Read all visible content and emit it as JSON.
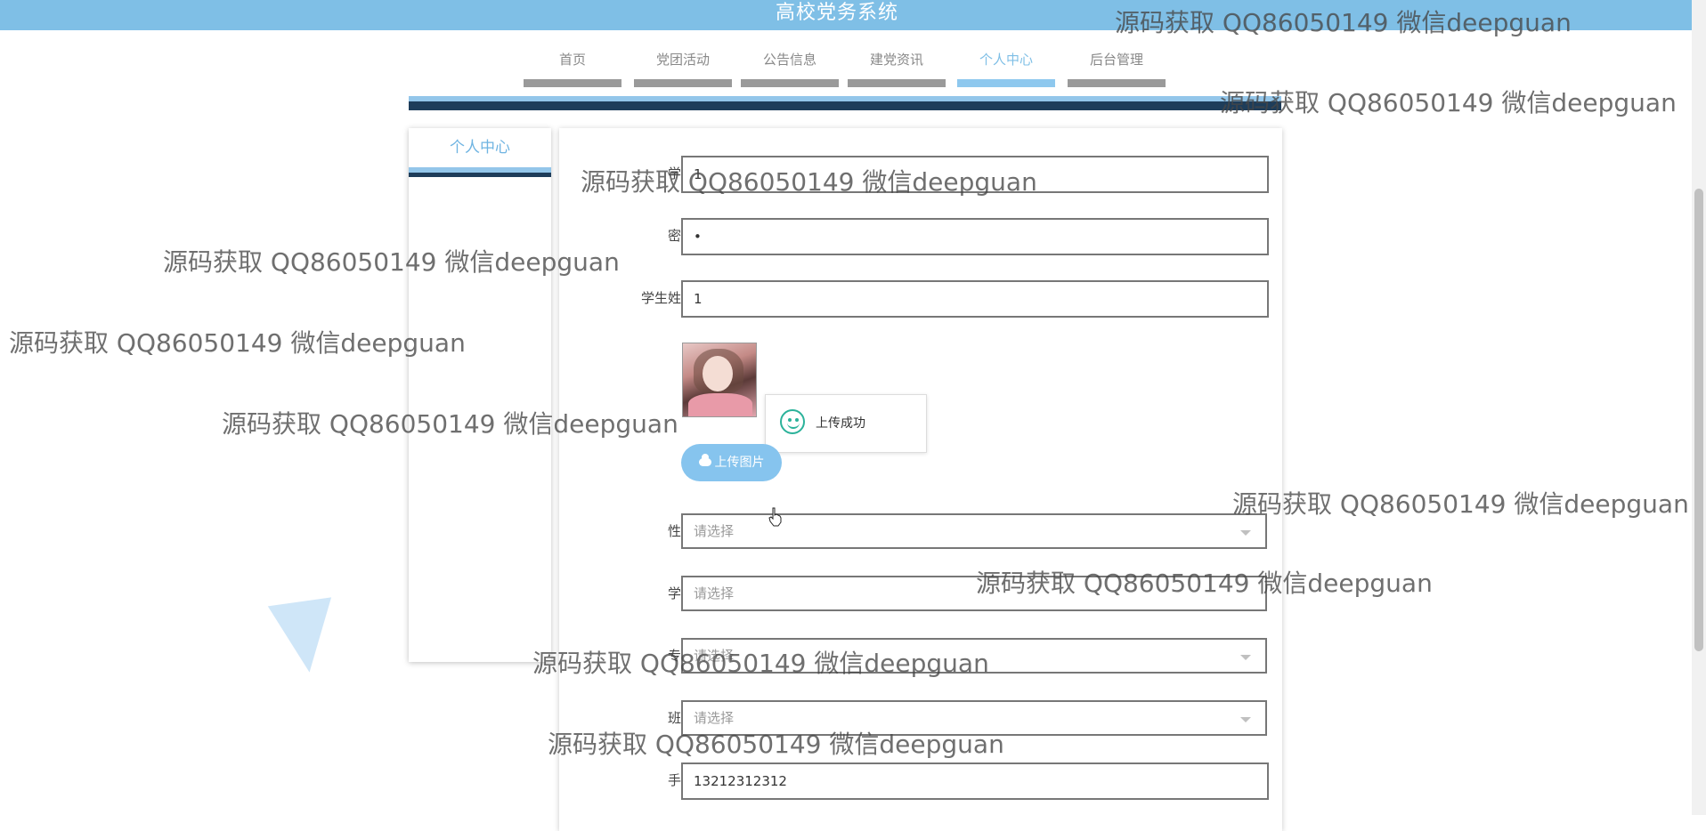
{
  "header": {
    "site_title": "高校党务系统"
  },
  "nav": {
    "items": [
      {
        "label": "首页"
      },
      {
        "label": "党团活动"
      },
      {
        "label": "公告信息"
      },
      {
        "label": "建党资讯"
      },
      {
        "label": "个人中心",
        "active": true
      },
      {
        "label": "后台管理"
      }
    ]
  },
  "sidebar": {
    "title": "个人中心"
  },
  "form": {
    "student_id": {
      "label": "学号",
      "value": "1"
    },
    "password": {
      "label": "密码",
      "value": "•"
    },
    "student_name": {
      "label": "学生姓名",
      "value": "1"
    },
    "upload_button_label": "上传图片",
    "gender": {
      "label": "性别",
      "placeholder": "请选择"
    },
    "college": {
      "label": "学院",
      "placeholder": "请选择"
    },
    "major": {
      "label": "专业",
      "placeholder": "请选择"
    },
    "class": {
      "label": "班级",
      "placeholder": "请选择"
    },
    "phone": {
      "label": "手机",
      "value": "13212312312"
    }
  },
  "toast": {
    "message": "上传成功"
  },
  "watermark": {
    "text": "源码获取 QQ86050149 微信deepguan"
  },
  "colors": {
    "accent": "#7fbfe6",
    "dark_bar": "#1e3d5a",
    "success": "#2bb29a"
  }
}
